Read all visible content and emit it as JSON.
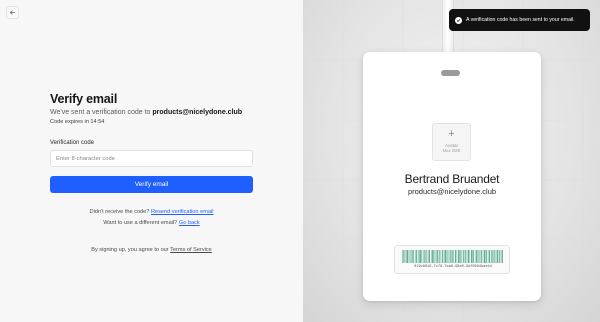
{
  "nav": {
    "back_icon": "arrow-left-icon"
  },
  "form": {
    "title": "Verify email",
    "sent_prefix": "We've sent a verification code to",
    "email": "products@nicelydone.club",
    "expires": "Code expires in 14:54",
    "code_label": "Verification code",
    "code_placeholder": "Enter 8-character code",
    "code_value": "",
    "verify_label": "Verify email"
  },
  "help": {
    "resend_prompt": "Didn't receive the code?",
    "resend_link": "Resend verification email",
    "different_prompt": "Want to use a different email?",
    "different_link": "Go back",
    "terms_prompt": "By signing up, you agree to our",
    "terms_link": "Terms of Service"
  },
  "badge": {
    "avatar_icon": "plus-icon",
    "avatar_label": "Avatar",
    "avatar_sub": "Max 2MB",
    "name": "Bertrand Bruandet",
    "email": "products@nicelydone.club",
    "barcode_text": "019c8816-7c78-7ea8-98e0-9df0694bae4d"
  },
  "toast": {
    "icon": "check-circle-icon",
    "message": "A verification code has been sent to your email."
  },
  "colors": {
    "accent": "#1f5fff",
    "toast_bg": "#111111",
    "barcode": "#5fae96"
  }
}
